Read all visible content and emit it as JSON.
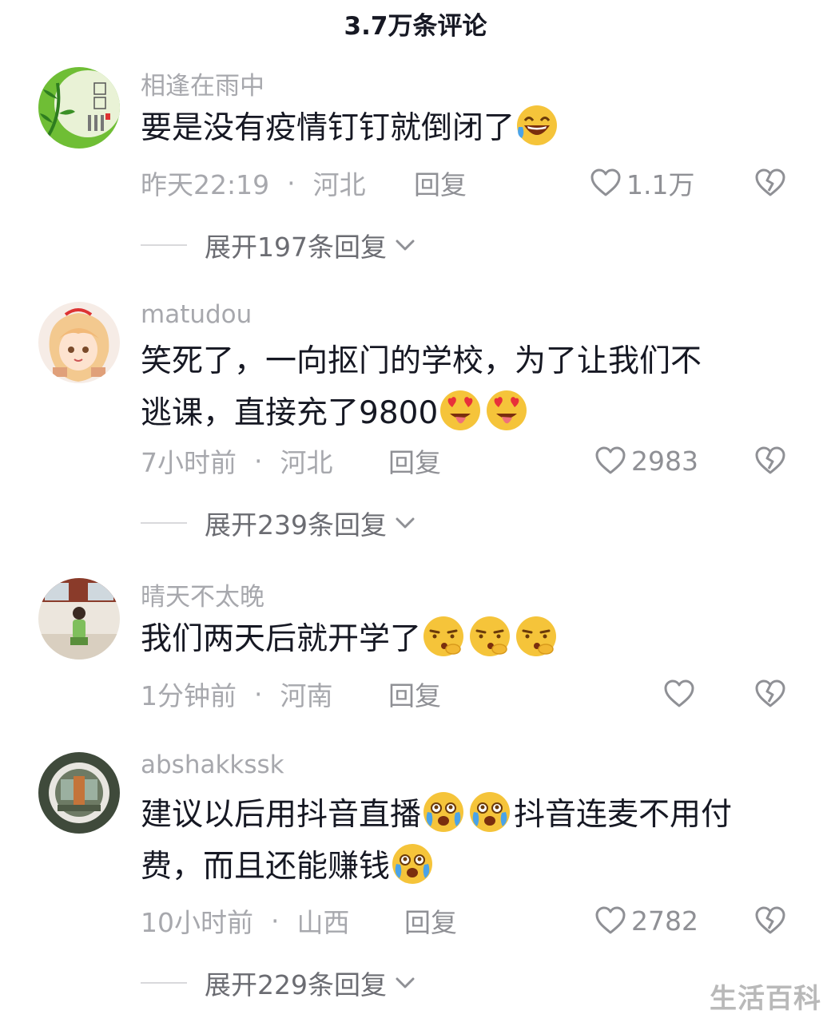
{
  "header": {
    "title": "3.7万条评论"
  },
  "comments": [
    {
      "username": "相逢在雨中",
      "lines": [
        "要是没有疫情钉钉就倒闭了"
      ],
      "time": "昨天22:19",
      "location": "河北",
      "reply_label": "回复",
      "likes": "1.1万",
      "expand": "展开197条回复"
    },
    {
      "username": "matudou",
      "lines": [
        "笑死了，一向抠门的学校，为了让我们不",
        "逃课，直接充了9800"
      ],
      "time": "7小时前",
      "location": "河北",
      "reply_label": "回复",
      "likes": "2983",
      "expand": "展开239条回复"
    },
    {
      "username": "晴天不太晚",
      "lines": [
        "我们两天后就开学了"
      ],
      "time": "1分钟前",
      "location": "河南",
      "reply_label": "回复",
      "likes": ""
    },
    {
      "username": "abshakkssk",
      "lines": [
        "建议以后用抖音直播",
        "抖音连麦不用付",
        "费，而且还能赚钱"
      ],
      "time": "10小时前",
      "location": "山西",
      "reply_label": "回复",
      "likes": "2782",
      "expand": "展开229条回复"
    }
  ],
  "icons": {
    "like": "heart-outline-icon",
    "dislike": "broken-heart-icon",
    "expand": "chevron-down-icon",
    "emoji_1": "laugh-cry-emoji",
    "emoji_2": "heart-eyes-tongue-emoji",
    "emoji_3": "kiss-whistle-emoji",
    "emoji_4": "tears-of-joy-sob-emoji"
  },
  "colors": {
    "text": "#161823",
    "meta": "#a7a8ad",
    "emoji": "#f5c43a"
  },
  "watermark": "生活百科"
}
